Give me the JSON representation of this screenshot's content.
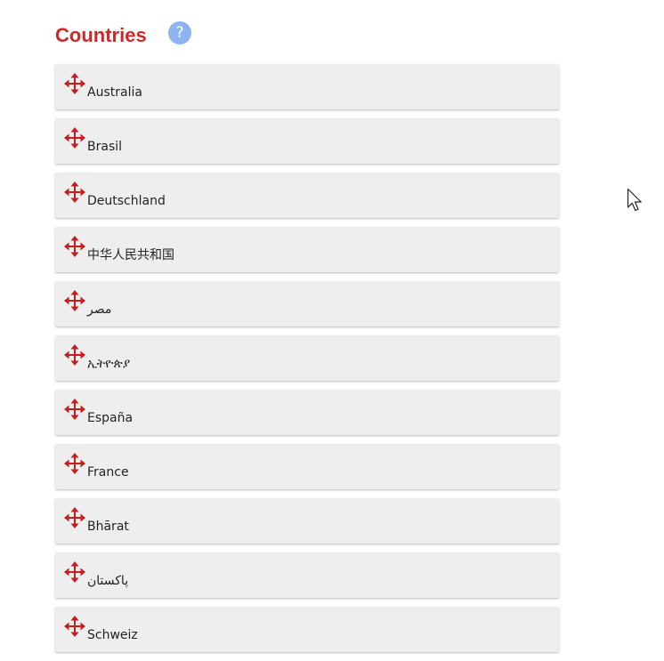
{
  "title": "Countries",
  "help": {
    "label": "?"
  },
  "icons": {
    "drag_handle": "move-arrows-icon",
    "help": "question-circle-icon",
    "cursor": "mouse-pointer-icon"
  },
  "colors": {
    "title": "#cc2a2a",
    "help_bg": "#8db4ee",
    "handle": "#c41e1e",
    "item_bg": "#eeeeee"
  },
  "countries": [
    "Australia",
    "Brasil",
    "Deutschland",
    "中华人民共和国",
    "مصر",
    "ኢትዮጵያ",
    "España",
    "France",
    " Bhārat",
    "پاکستان",
    "Schweiz"
  ]
}
